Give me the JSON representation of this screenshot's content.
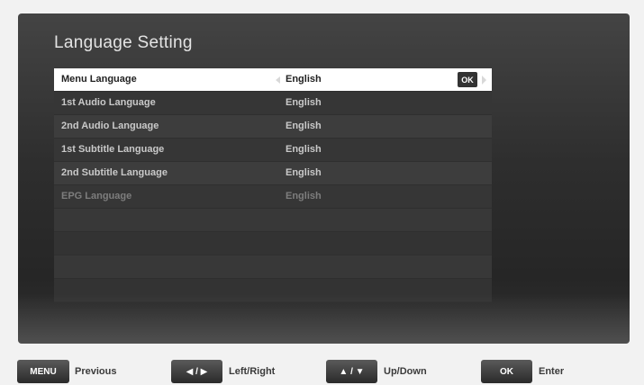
{
  "page": {
    "title": "Language Setting"
  },
  "menu": {
    "items": [
      {
        "label": "Menu Language",
        "value": "English",
        "selected": true
      },
      {
        "label": "1st Audio Language",
        "value": "English"
      },
      {
        "label": "2nd Audio Language",
        "value": "English"
      },
      {
        "label": "1st Subtitle Language",
        "value": "English"
      },
      {
        "label": "2nd Subtitle Language",
        "value": "English"
      },
      {
        "label": "EPG Language",
        "value": "English"
      }
    ],
    "ok_label": "OK"
  },
  "help_bar": {
    "items": [
      {
        "key": "MENU",
        "label": "Previous",
        "icon": "menu-key"
      },
      {
        "key": "◀ / ▶",
        "label": "Left/Right",
        "icon": "left-right-key"
      },
      {
        "key": "▲ / ▼",
        "label": "Up/Down",
        "icon": "up-down-key"
      },
      {
        "key": "OK",
        "label": "Enter",
        "icon": "ok-key"
      }
    ]
  },
  "colors": {
    "panel_bg": "#2e2e2e",
    "row_bg": "#3d3d3d",
    "selected_row_bg": "#ffffff",
    "text": "#c9c9c9"
  }
}
